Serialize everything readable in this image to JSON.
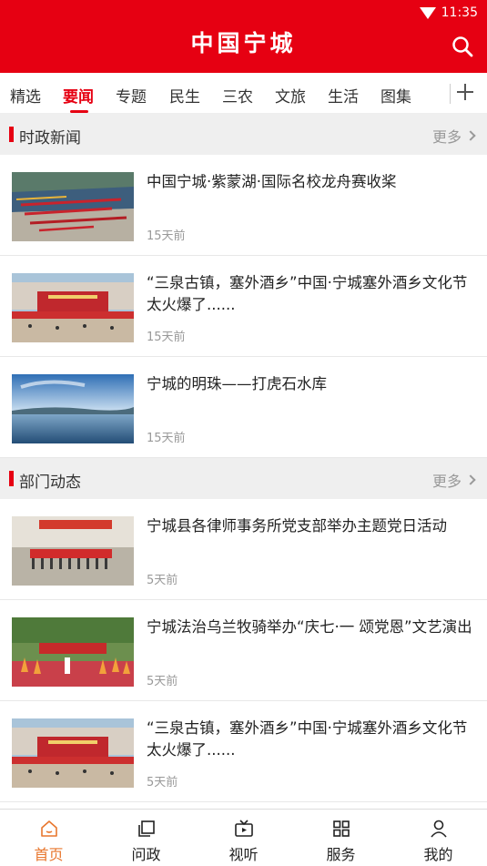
{
  "status_bar": {
    "time": "11:35"
  },
  "header": {
    "title": "中国宁城"
  },
  "tabs": [
    {
      "label": "精选"
    },
    {
      "label": "要闻",
      "active": true
    },
    {
      "label": "专题"
    },
    {
      "label": "民生"
    },
    {
      "label": "三农"
    },
    {
      "label": "文旅"
    },
    {
      "label": "生活"
    },
    {
      "label": "图集"
    }
  ],
  "sections": [
    {
      "title": "时政新闻",
      "more": "更多",
      "items": [
        {
          "title": "中国宁城·紫蒙湖·国际名校龙舟赛收桨",
          "time": "15天前"
        },
        {
          "title": "“三泉古镇，塞外酒乡”中国·宁城塞外酒乡文化节太火爆了......",
          "time": "15天前"
        },
        {
          "title": "宁城的明珠——打虎石水库",
          "time": "15天前"
        }
      ]
    },
    {
      "title": "部门动态",
      "more": "更多",
      "items": [
        {
          "title": "宁城县各律师事务所党支部举办主题党日活动",
          "time": "5天前"
        },
        {
          "title": "宁城法治乌兰牧骑举办“庆七·一 颂党恩”文艺演出",
          "time": "5天前"
        },
        {
          "title": "“三泉古镇，塞外酒乡”中国·宁城塞外酒乡文化节太火爆了......",
          "time": "5天前"
        }
      ]
    }
  ],
  "bottom_nav": [
    {
      "label": "首页",
      "icon": "home-icon",
      "active": true
    },
    {
      "label": "问政",
      "icon": "square-stack-icon"
    },
    {
      "label": "视听",
      "icon": "tv-icon"
    },
    {
      "label": "服务",
      "icon": "grid-icon"
    },
    {
      "label": "我的",
      "icon": "person-icon"
    }
  ],
  "colors": {
    "brand_red": "#e60012",
    "nav_active": "#e8772e"
  }
}
